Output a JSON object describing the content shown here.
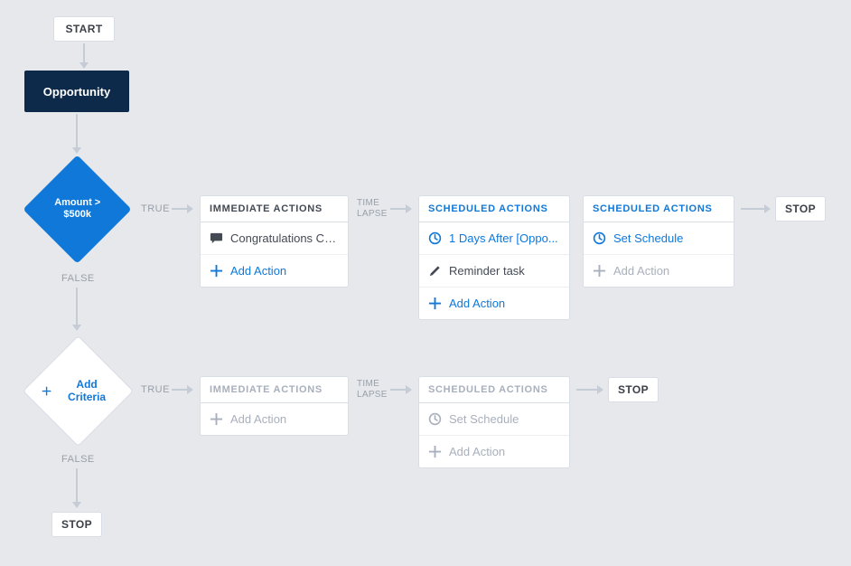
{
  "start_label": "START",
  "trigger_label": "Opportunity",
  "criteria1": {
    "label_line1": "Amount >",
    "label_line2": "$500k",
    "true_label": "TRUE",
    "false_label": "FALSE",
    "immediate_header": "IMMEDIATE ACTIONS",
    "action1": "Congratulations Ch...",
    "add_action": "Add Action",
    "time_lapse_line1": "TIME",
    "time_lapse_line2": "LAPSE",
    "sched1_header": "SCHEDULED ACTIONS",
    "sched1_clock": "1 Days After [Oppo...",
    "sched1_task": "Reminder task",
    "sched1_add": "Add Action",
    "sched2_header": "SCHEDULED ACTIONS",
    "sched2_clock": "Set Schedule",
    "sched2_add": "Add Action",
    "stop_label": "STOP"
  },
  "criteria2": {
    "add_criteria": "Add Criteria",
    "true_label": "TRUE",
    "false_label": "FALSE",
    "immediate_header": "IMMEDIATE ACTIONS",
    "immediate_add": "Add Action",
    "time_lapse_line1": "TIME",
    "time_lapse_line2": "LAPSE",
    "sched_header": "SCHEDULED ACTIONS",
    "sched_clock": "Set Schedule",
    "sched_add": "Add Action",
    "stop_label": "STOP"
  },
  "final_stop": "STOP"
}
